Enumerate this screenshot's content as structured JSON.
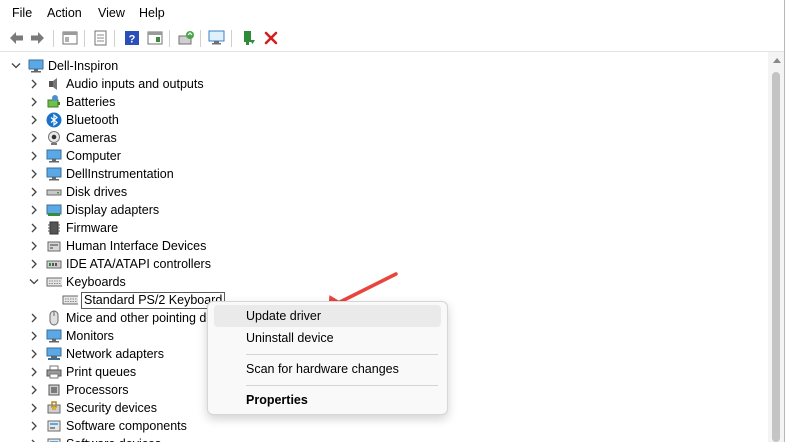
{
  "menu": [
    "File",
    "Action",
    "View",
    "Help"
  ],
  "toolbar_icons": [
    "back-arrow-icon",
    "forward-arrow-icon",
    "show-hide-tree-icon",
    "properties-icon",
    "help-icon",
    "action-pane-icon",
    "update-driver-icon",
    "scan-hardware-icon",
    "enable-device-icon",
    "uninstall-device-icon"
  ],
  "tree": {
    "root": "Dell-Inspiron",
    "categories": [
      {
        "label": "Audio inputs and outputs",
        "icon": "speaker-icon"
      },
      {
        "label": "Batteries",
        "icon": "battery-icon"
      },
      {
        "label": "Bluetooth",
        "icon": "bluetooth-icon"
      },
      {
        "label": "Cameras",
        "icon": "camera-icon"
      },
      {
        "label": "Computer",
        "icon": "monitor-icon"
      },
      {
        "label": "DellInstrumentation",
        "icon": "monitor-icon"
      },
      {
        "label": "Disk drives",
        "icon": "disk-icon"
      },
      {
        "label": "Display adapters",
        "icon": "display-adapter-icon"
      },
      {
        "label": "Firmware",
        "icon": "chip-icon"
      },
      {
        "label": "Human Interface Devices",
        "icon": "hid-icon"
      },
      {
        "label": "IDE ATA/ATAPI controllers",
        "icon": "ide-icon"
      },
      {
        "label": "Keyboards",
        "icon": "keyboard-icon",
        "expanded": true,
        "children": [
          "Standard PS/2 Keyboard"
        ]
      },
      {
        "label": "Mice and other pointing de",
        "icon": "mouse-icon"
      },
      {
        "label": "Monitors",
        "icon": "monitor-icon"
      },
      {
        "label": "Network adapters",
        "icon": "network-icon"
      },
      {
        "label": "Print queues",
        "icon": "printer-icon"
      },
      {
        "label": "Processors",
        "icon": "cpu-icon"
      },
      {
        "label": "Security devices",
        "icon": "security-icon"
      },
      {
        "label": "Software components",
        "icon": "software-icon"
      },
      {
        "label": "Software devices",
        "icon": "software-icon"
      }
    ]
  },
  "context_menu": {
    "items": [
      "Update driver",
      "Uninstall device",
      "Scan for hardware changes",
      "Properties"
    ],
    "highlighted": "Update driver"
  },
  "colors": {
    "accent_blue": "#1a73c9",
    "arrow_red": "#e8453c",
    "delete_red": "#d21f1f",
    "green": "#2e8b3a"
  }
}
